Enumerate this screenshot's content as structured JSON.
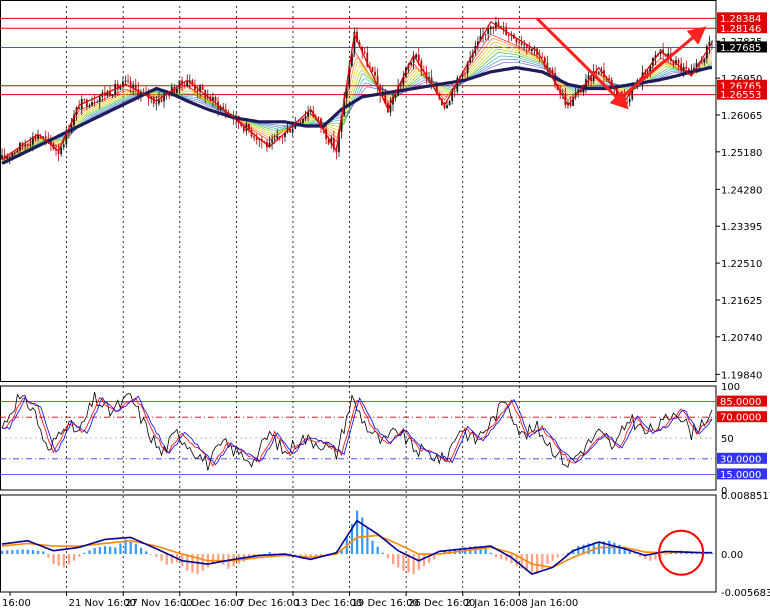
{
  "colors": {
    "background": "#ffffff",
    "axis": "#000000",
    "grid_vertical": "#000000",
    "candle_up": "#1a1a1a",
    "candle_down": "#c00000",
    "zigzag": "#e00000",
    "ma_thick": "#1c1c5a",
    "level_red": "#e00000",
    "level_blue": "#3333ff",
    "stoch_main": "#000000",
    "stoch_signal": "#ff0000",
    "stoch_blue": "#0000ff",
    "macd_hist_up": "#3399ff",
    "macd_hist_down": "#ffa080",
    "macd_line": "#000099",
    "macd_signal": "#ff8800",
    "circle": "#ff0000",
    "arrow": "#ff2020"
  },
  "chart_data": [
    {
      "type": "candlestick",
      "panel": "price",
      "title": "",
      "y_ticks": [
        "1.27835",
        "1.26950",
        "1.26065",
        "1.25180",
        "1.24280",
        "1.23395",
        "1.22510",
        "1.21625",
        "1.20740",
        "1.19840"
      ],
      "ylim": [
        1.1968,
        1.2868
      ],
      "current_price": "1.27685",
      "price_levels": [
        {
          "label": "1.28384",
          "value": 1.28384,
          "color": "red"
        },
        {
          "label": "1.28146",
          "value": 1.28146,
          "color": "red"
        },
        {
          "label": "1.26765",
          "value": 1.26765,
          "color": "red"
        },
        {
          "label": "1.26553",
          "value": 1.26553,
          "color": "red"
        }
      ],
      "blue_level": 1.27685,
      "trend_path": [
        [
          0,
          1.249
        ],
        [
          10,
          1.252
        ],
        [
          20,
          1.255
        ],
        [
          30,
          1.258
        ],
        [
          40,
          1.261
        ],
        [
          50,
          1.264
        ],
        [
          60,
          1.267
        ],
        [
          65,
          1.266
        ],
        [
          72,
          1.264
        ],
        [
          80,
          1.262
        ],
        [
          90,
          1.26
        ],
        [
          100,
          1.259
        ],
        [
          110,
          1.259
        ],
        [
          118,
          1.258
        ],
        [
          125,
          1.258
        ],
        [
          132,
          1.262
        ],
        [
          140,
          1.265
        ],
        [
          150,
          1.266
        ],
        [
          160,
          1.267
        ],
        [
          170,
          1.268
        ],
        [
          180,
          1.269
        ],
        [
          190,
          1.271
        ],
        [
          200,
          1.272
        ],
        [
          210,
          1.271
        ],
        [
          220,
          1.268
        ],
        [
          228,
          1.267
        ],
        [
          235,
          1.267
        ],
        [
          245,
          1.268
        ],
        [
          255,
          1.269
        ],
        [
          262,
          1.27
        ],
        [
          268,
          1.271
        ],
        [
          275,
          1.272
        ]
      ],
      "zigzag": [
        [
          0,
          1.25
        ],
        [
          14,
          1.256
        ],
        [
          22,
          1.252
        ],
        [
          30,
          1.263
        ],
        [
          48,
          1.268
        ],
        [
          60,
          1.264
        ],
        [
          72,
          1.269
        ],
        [
          104,
          1.253
        ],
        [
          120,
          1.262
        ],
        [
          130,
          1.252
        ],
        [
          137,
          1.28
        ],
        [
          150,
          1.262
        ],
        [
          160,
          1.275
        ],
        [
          172,
          1.263
        ],
        [
          190,
          1.283
        ],
        [
          208,
          1.276
        ],
        [
          220,
          1.263
        ],
        [
          232,
          1.272
        ],
        [
          242,
          1.264
        ],
        [
          256,
          1.276
        ],
        [
          268,
          1.27
        ],
        [
          276,
          1.278
        ]
      ],
      "arrows": [
        {
          "from": [
            208,
            1.2838
          ],
          "to": [
            242,
            1.263
          ]
        },
        {
          "from": [
            242,
            1.2655
          ],
          "to": [
            272,
            1.281
          ]
        }
      ]
    },
    {
      "type": "line",
      "panel": "stochastic",
      "y_ticks": [
        "100",
        "50",
        "0"
      ],
      "ylim": [
        0,
        100
      ],
      "levels": [
        {
          "label": "85.0000",
          "value": 85,
          "style": "solid"
        },
        {
          "label": "70.0000",
          "value": 70,
          "style": "dashed"
        },
        {
          "label": "30.0000",
          "value": 30,
          "style": "dashed"
        },
        {
          "label": "15.0000",
          "value": 15,
          "style": "solid"
        }
      ],
      "series": [
        {
          "values": [
            [
              0,
              60
            ],
            [
              6,
              88
            ],
            [
              12,
              80
            ],
            [
              18,
              35
            ],
            [
              24,
              65
            ],
            [
              30,
              55
            ],
            [
              36,
              88
            ],
            [
              42,
              75
            ],
            [
              50,
              90
            ],
            [
              56,
              60
            ],
            [
              62,
              35
            ],
            [
              68,
              55
            ],
            [
              74,
              40
            ],
            [
              80,
              25
            ],
            [
              86,
              45
            ],
            [
              92,
              35
            ],
            [
              98,
              28
            ],
            [
              104,
              55
            ],
            [
              110,
              35
            ],
            [
              116,
              50
            ],
            [
              124,
              45
            ],
            [
              130,
              35
            ],
            [
              136,
              88
            ],
            [
              142,
              60
            ],
            [
              148,
              45
            ],
            [
              154,
              58
            ],
            [
              160,
              40
            ],
            [
              166,
              35
            ],
            [
              172,
              28
            ],
            [
              178,
              60
            ],
            [
              184,
              48
            ],
            [
              190,
              65
            ],
            [
              196,
              88
            ],
            [
              202,
              52
            ],
            [
              208,
              60
            ],
            [
              214,
              40
            ],
            [
              220,
              25
            ],
            [
              226,
              40
            ],
            [
              232,
              55
            ],
            [
              238,
              40
            ],
            [
              244,
              70
            ],
            [
              250,
              55
            ],
            [
              256,
              62
            ],
            [
              262,
              78
            ],
            [
              268,
              55
            ],
            [
              274,
              70
            ]
          ]
        }
      ]
    },
    {
      "type": "bar",
      "panel": "macd",
      "y_ticks": [
        "0.0088517",
        "0.00",
        "-0.005683"
      ],
      "ylim": [
        -0.005683,
        0.0088517
      ],
      "hist": [
        [
          0,
          0.0005
        ],
        [
          4,
          0.0006
        ],
        [
          8,
          0.0007
        ],
        [
          12,
          0.0006
        ],
        [
          16,
          0.0004
        ],
        [
          20,
          -0.0015
        ],
        [
          24,
          -0.002
        ],
        [
          28,
          -0.001
        ],
        [
          32,
          0.0002
        ],
        [
          36,
          0.0009
        ],
        [
          40,
          0.0012
        ],
        [
          44,
          0.001
        ],
        [
          48,
          0.0022
        ],
        [
          52,
          0.0015
        ],
        [
          56,
          0.0004
        ],
        [
          60,
          -0.0004
        ],
        [
          64,
          -0.0016
        ],
        [
          68,
          -0.0012
        ],
        [
          72,
          -0.0025
        ],
        [
          76,
          -0.003
        ],
        [
          80,
          -0.002
        ],
        [
          84,
          -0.001
        ],
        [
          88,
          -0.0022
        ],
        [
          92,
          -0.0015
        ],
        [
          96,
          -0.0008
        ],
        [
          100,
          -0.0003
        ],
        [
          104,
          0.0003
        ],
        [
          108,
          -0.0002
        ],
        [
          112,
          0.0001
        ],
        [
          116,
          -0.0004
        ],
        [
          120,
          -0.0006
        ],
        [
          124,
          -0.0003
        ],
        [
          128,
          -0.0001
        ],
        [
          132,
          0.0008
        ],
        [
          136,
          0.0045
        ],
        [
          138,
          0.0065
        ],
        [
          140,
          0.0055
        ],
        [
          142,
          0.004
        ],
        [
          144,
          0.002
        ],
        [
          148,
          0.0002
        ],
        [
          152,
          -0.0015
        ],
        [
          156,
          -0.0025
        ],
        [
          160,
          -0.003
        ],
        [
          164,
          -0.0018
        ],
        [
          168,
          -0.0008
        ],
        [
          172,
          0.0006
        ],
        [
          176,
          0.0008
        ],
        [
          180,
          0.001
        ],
        [
          184,
          0.0012
        ],
        [
          188,
          0.0009
        ],
        [
          192,
          -0.0005
        ],
        [
          196,
          -0.001
        ],
        [
          200,
          -0.0018
        ],
        [
          204,
          -0.0025
        ],
        [
          208,
          -0.003
        ],
        [
          212,
          -0.0015
        ],
        [
          216,
          -0.0005
        ],
        [
          220,
          0.0002
        ],
        [
          224,
          0.0012
        ],
        [
          228,
          0.0016
        ],
        [
          232,
          0.0018
        ],
        [
          236,
          0.002
        ],
        [
          240,
          0.0014
        ],
        [
          244,
          0.0006
        ],
        [
          248,
          -0.0004
        ],
        [
          252,
          -0.001
        ],
        [
          256,
          -0.0006
        ],
        [
          260,
          0.0003
        ],
        [
          264,
          0.0005
        ],
        [
          268,
          0.0002
        ]
      ],
      "macd_line": [
        [
          0,
          0.0015
        ],
        [
          10,
          0.002
        ],
        [
          20,
          0.0005
        ],
        [
          30,
          0.001
        ],
        [
          40,
          0.0022
        ],
        [
          50,
          0.0025
        ],
        [
          60,
          0.0008
        ],
        [
          70,
          -0.001
        ],
        [
          80,
          -0.0015
        ],
        [
          90,
          -0.0008
        ],
        [
          100,
          -0.0002
        ],
        [
          110,
          0.0
        ],
        [
          120,
          -0.0008
        ],
        [
          130,
          0.0002
        ],
        [
          138,
          0.005
        ],
        [
          146,
          0.003
        ],
        [
          154,
          0.0005
        ],
        [
          162,
          -0.001
        ],
        [
          170,
          0.0004
        ],
        [
          180,
          0.0008
        ],
        [
          190,
          0.0012
        ],
        [
          198,
          -0.0005
        ],
        [
          206,
          -0.003
        ],
        [
          214,
          -0.002
        ],
        [
          222,
          0.0005
        ],
        [
          232,
          0.0018
        ],
        [
          242,
          0.0008
        ],
        [
          250,
          -0.0002
        ],
        [
          258,
          0.0004
        ],
        [
          266,
          0.0003
        ],
        [
          272,
          0.0002
        ]
      ],
      "signal_line": [
        [
          0,
          0.0012
        ],
        [
          10,
          0.0016
        ],
        [
          20,
          0.0012
        ],
        [
          30,
          0.0012
        ],
        [
          40,
          0.0016
        ],
        [
          50,
          0.002
        ],
        [
          60,
          0.0012
        ],
        [
          70,
          0.0
        ],
        [
          80,
          -0.001
        ],
        [
          90,
          -0.001
        ],
        [
          100,
          -0.0005
        ],
        [
          110,
          -0.0002
        ],
        [
          120,
          -0.0005
        ],
        [
          130,
          0.0
        ],
        [
          138,
          0.0025
        ],
        [
          146,
          0.0028
        ],
        [
          154,
          0.0015
        ],
        [
          162,
          0.0
        ],
        [
          170,
          0.0
        ],
        [
          180,
          0.0005
        ],
        [
          190,
          0.001
        ],
        [
          198,
          0.0002
        ],
        [
          206,
          -0.0015
        ],
        [
          214,
          -0.002
        ],
        [
          222,
          -0.0005
        ],
        [
          232,
          0.001
        ],
        [
          242,
          0.001
        ],
        [
          250,
          0.0003
        ],
        [
          258,
          0.0002
        ],
        [
          266,
          0.0003
        ],
        [
          272,
          0.0002
        ]
      ]
    }
  ],
  "x_axis": {
    "labels": [
      "16:00",
      "21 Nov 16:00",
      "27 Nov 16:00",
      "1 Dec 16:00",
      "7 Dec 16:00",
      "13 Dec 16:00",
      "19 Dec 16:00",
      "26 Dec 16:00",
      "2 Jan 16:00",
      "8 Jan 16:00"
    ],
    "label_positions": [
      0,
      22,
      44,
      66,
      88,
      110,
      132,
      154,
      176,
      198
    ]
  }
}
